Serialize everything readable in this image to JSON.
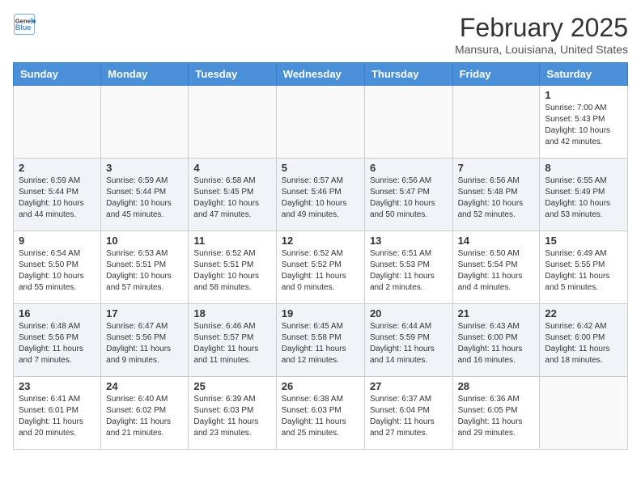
{
  "header": {
    "logo_line1": "General",
    "logo_line2": "Blue",
    "month_title": "February 2025",
    "location": "Mansura, Louisiana, United States"
  },
  "weekdays": [
    "Sunday",
    "Monday",
    "Tuesday",
    "Wednesday",
    "Thursday",
    "Friday",
    "Saturday"
  ],
  "weeks": [
    [
      {
        "day": "",
        "info": ""
      },
      {
        "day": "",
        "info": ""
      },
      {
        "day": "",
        "info": ""
      },
      {
        "day": "",
        "info": ""
      },
      {
        "day": "",
        "info": ""
      },
      {
        "day": "",
        "info": ""
      },
      {
        "day": "1",
        "info": "Sunrise: 7:00 AM\nSunset: 5:43 PM\nDaylight: 10 hours\nand 42 minutes."
      }
    ],
    [
      {
        "day": "2",
        "info": "Sunrise: 6:59 AM\nSunset: 5:44 PM\nDaylight: 10 hours\nand 44 minutes."
      },
      {
        "day": "3",
        "info": "Sunrise: 6:59 AM\nSunset: 5:44 PM\nDaylight: 10 hours\nand 45 minutes."
      },
      {
        "day": "4",
        "info": "Sunrise: 6:58 AM\nSunset: 5:45 PM\nDaylight: 10 hours\nand 47 minutes."
      },
      {
        "day": "5",
        "info": "Sunrise: 6:57 AM\nSunset: 5:46 PM\nDaylight: 10 hours\nand 49 minutes."
      },
      {
        "day": "6",
        "info": "Sunrise: 6:56 AM\nSunset: 5:47 PM\nDaylight: 10 hours\nand 50 minutes."
      },
      {
        "day": "7",
        "info": "Sunrise: 6:56 AM\nSunset: 5:48 PM\nDaylight: 10 hours\nand 52 minutes."
      },
      {
        "day": "8",
        "info": "Sunrise: 6:55 AM\nSunset: 5:49 PM\nDaylight: 10 hours\nand 53 minutes."
      }
    ],
    [
      {
        "day": "9",
        "info": "Sunrise: 6:54 AM\nSunset: 5:50 PM\nDaylight: 10 hours\nand 55 minutes."
      },
      {
        "day": "10",
        "info": "Sunrise: 6:53 AM\nSunset: 5:51 PM\nDaylight: 10 hours\nand 57 minutes."
      },
      {
        "day": "11",
        "info": "Sunrise: 6:52 AM\nSunset: 5:51 PM\nDaylight: 10 hours\nand 58 minutes."
      },
      {
        "day": "12",
        "info": "Sunrise: 6:52 AM\nSunset: 5:52 PM\nDaylight: 11 hours\nand 0 minutes."
      },
      {
        "day": "13",
        "info": "Sunrise: 6:51 AM\nSunset: 5:53 PM\nDaylight: 11 hours\nand 2 minutes."
      },
      {
        "day": "14",
        "info": "Sunrise: 6:50 AM\nSunset: 5:54 PM\nDaylight: 11 hours\nand 4 minutes."
      },
      {
        "day": "15",
        "info": "Sunrise: 6:49 AM\nSunset: 5:55 PM\nDaylight: 11 hours\nand 5 minutes."
      }
    ],
    [
      {
        "day": "16",
        "info": "Sunrise: 6:48 AM\nSunset: 5:56 PM\nDaylight: 11 hours\nand 7 minutes."
      },
      {
        "day": "17",
        "info": "Sunrise: 6:47 AM\nSunset: 5:56 PM\nDaylight: 11 hours\nand 9 minutes."
      },
      {
        "day": "18",
        "info": "Sunrise: 6:46 AM\nSunset: 5:57 PM\nDaylight: 11 hours\nand 11 minutes."
      },
      {
        "day": "19",
        "info": "Sunrise: 6:45 AM\nSunset: 5:58 PM\nDaylight: 11 hours\nand 12 minutes."
      },
      {
        "day": "20",
        "info": "Sunrise: 6:44 AM\nSunset: 5:59 PM\nDaylight: 11 hours\nand 14 minutes."
      },
      {
        "day": "21",
        "info": "Sunrise: 6:43 AM\nSunset: 6:00 PM\nDaylight: 11 hours\nand 16 minutes."
      },
      {
        "day": "22",
        "info": "Sunrise: 6:42 AM\nSunset: 6:00 PM\nDaylight: 11 hours\nand 18 minutes."
      }
    ],
    [
      {
        "day": "23",
        "info": "Sunrise: 6:41 AM\nSunset: 6:01 PM\nDaylight: 11 hours\nand 20 minutes."
      },
      {
        "day": "24",
        "info": "Sunrise: 6:40 AM\nSunset: 6:02 PM\nDaylight: 11 hours\nand 21 minutes."
      },
      {
        "day": "25",
        "info": "Sunrise: 6:39 AM\nSunset: 6:03 PM\nDaylight: 11 hours\nand 23 minutes."
      },
      {
        "day": "26",
        "info": "Sunrise: 6:38 AM\nSunset: 6:03 PM\nDaylight: 11 hours\nand 25 minutes."
      },
      {
        "day": "27",
        "info": "Sunrise: 6:37 AM\nSunset: 6:04 PM\nDaylight: 11 hours\nand 27 minutes."
      },
      {
        "day": "28",
        "info": "Sunrise: 6:36 AM\nSunset: 6:05 PM\nDaylight: 11 hours\nand 29 minutes."
      },
      {
        "day": "",
        "info": ""
      }
    ]
  ]
}
